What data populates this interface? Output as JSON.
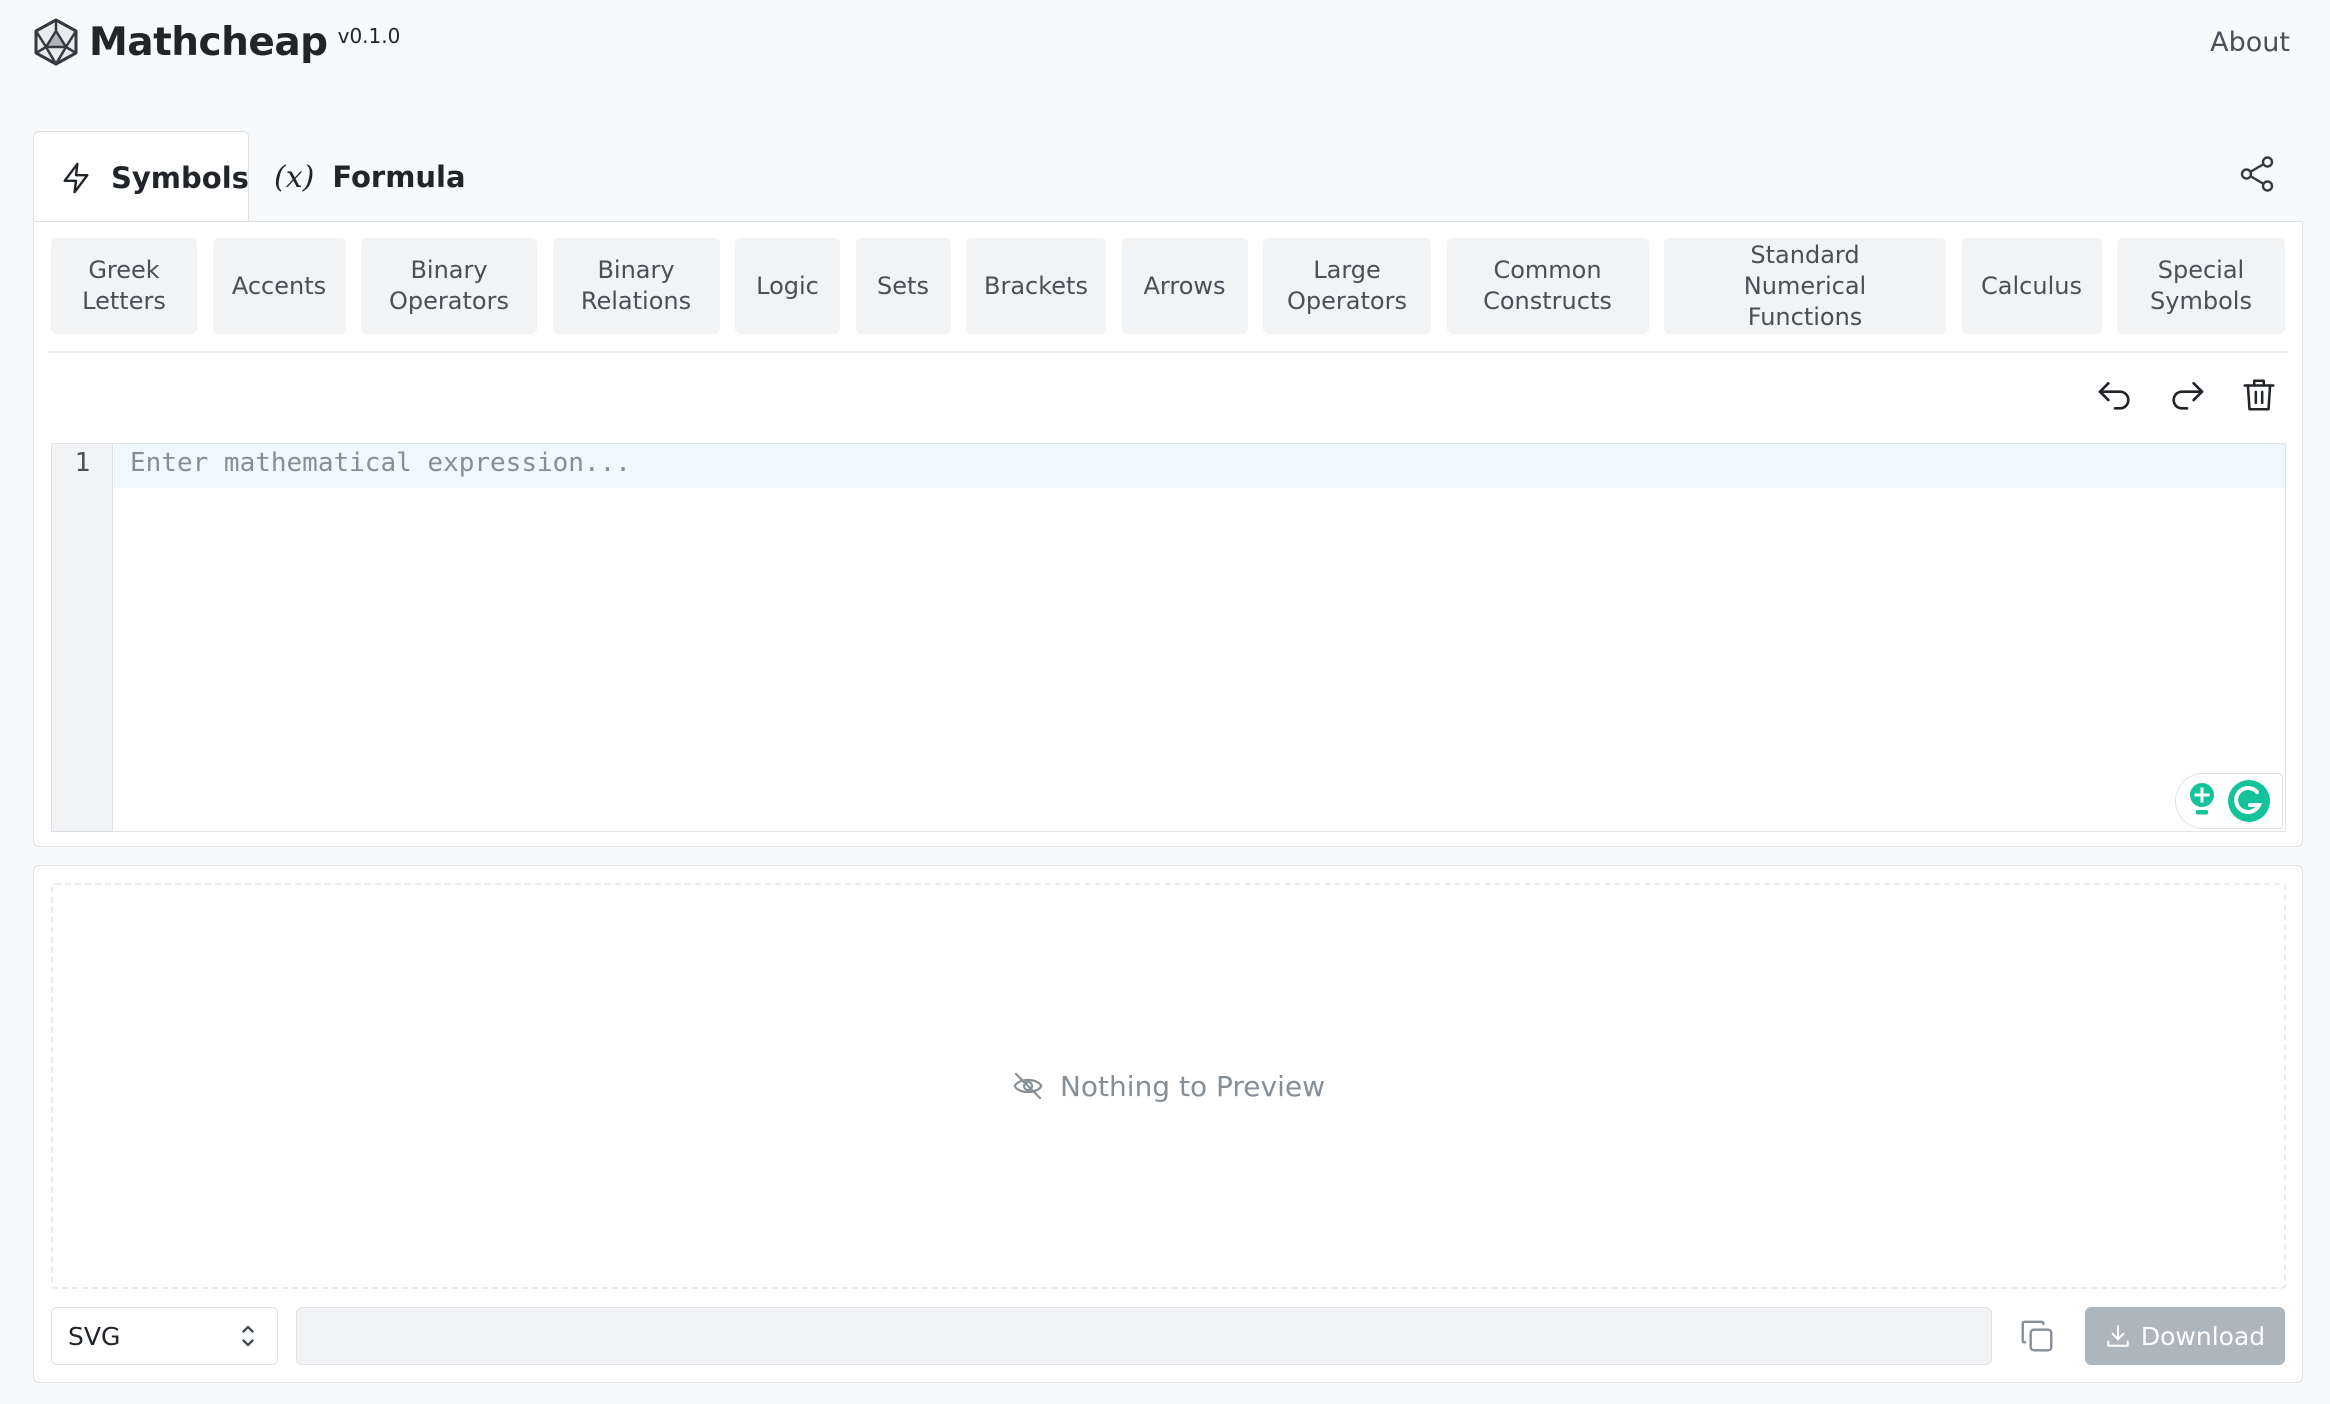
{
  "app": {
    "name": "Mathcheap",
    "version": "v0.1.0",
    "about_label": "About"
  },
  "tabs": [
    {
      "label": "Symbols",
      "icon": "lightning-icon",
      "active": true
    },
    {
      "label": "Formula",
      "icon": "function-x-icon",
      "glyph": "(𝑥)",
      "active": false
    }
  ],
  "categories": [
    {
      "label": "Greek Letters"
    },
    {
      "label": "Accents"
    },
    {
      "label": "Binary Operators"
    },
    {
      "label": "Binary Relations"
    },
    {
      "label": "Logic"
    },
    {
      "label": "Sets"
    },
    {
      "label": "Brackets"
    },
    {
      "label": "Arrows"
    },
    {
      "label": "Large Operators"
    },
    {
      "label": "Common Constructs"
    },
    {
      "label": "Standard Numerical Functions"
    },
    {
      "label": "Calculus"
    },
    {
      "label": "Special Symbols"
    }
  ],
  "editor": {
    "line_number": "1",
    "placeholder": "Enter mathematical expression...",
    "value": ""
  },
  "preview": {
    "empty_message": "Nothing to Preview"
  },
  "export": {
    "format": "SVG",
    "output_value": "",
    "download_label": "Download"
  },
  "colors": {
    "background": "#f8f9fa",
    "panel": "#ffffff",
    "button_bg": "#f1f3f5",
    "disabled_button": "#adb5bd",
    "grammarly_green": "#15c39a"
  }
}
